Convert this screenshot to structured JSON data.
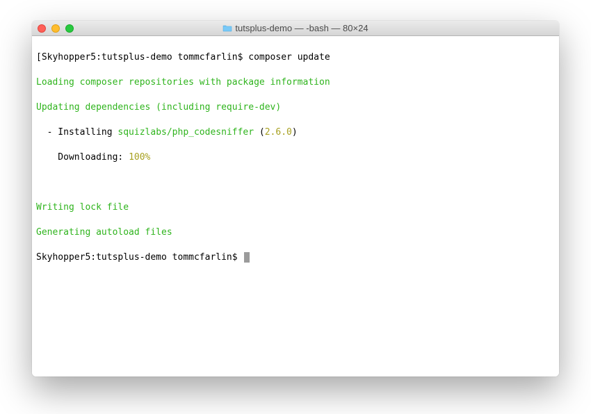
{
  "window": {
    "title": "tutsplus-demo — -bash — 80×24",
    "folder_name": "tutsplus-demo"
  },
  "terminal": {
    "prompt1_prefix": "[",
    "prompt1": "Skyhopper5:tutsplus-demo tommcfarlin$ ",
    "command1": "composer update",
    "line_loading": "Loading composer repositories with package information",
    "line_updating": "Updating dependencies (including require-dev)",
    "line_install_pre": "  - Installing ",
    "line_install_pkg": "squizlabs/php_codesniffer",
    "line_install_paren_open": " (",
    "line_install_ver": "2.6.0",
    "line_install_paren_close": ")",
    "line_download_pre": "    Downloading: ",
    "line_download_pct": "100%",
    "line_writing": "Writing lock file",
    "line_generating": "Generating autoload files",
    "prompt2": "Skyhopper5:tutsplus-demo tommcfarlin$ "
  }
}
